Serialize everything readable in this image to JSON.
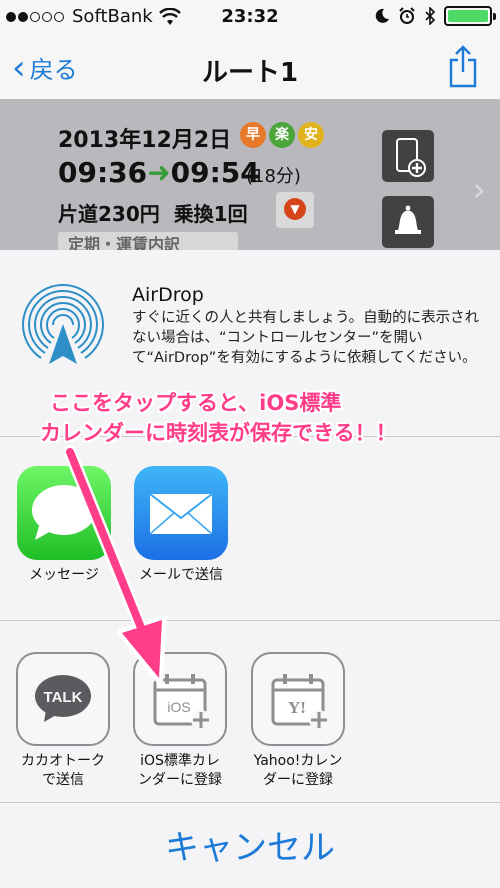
{
  "status_bar": {
    "carrier": "SoftBank",
    "time": "23:32"
  },
  "nav": {
    "back_label": "戻る",
    "title": "ルート1",
    "icons": [
      "chevron-left-icon",
      "share-icon"
    ]
  },
  "route": {
    "date": "2013年12月2日",
    "badges": [
      {
        "text": "早",
        "color": "#e8782a"
      },
      {
        "text": "楽",
        "color": "#4aa53a"
      },
      {
        "text": "安",
        "color": "#e0b21e"
      }
    ],
    "departure": "09:36",
    "arrival": "09:54",
    "duration": "(18分)",
    "fare": "片道230円",
    "transfers": "乗換1回",
    "tag": "定期・運賃内訳",
    "side_icons": [
      "add-to-phone-icon",
      "bell-icon"
    ]
  },
  "share_sheet": {
    "airdrop": {
      "title": "AirDrop",
      "description": "すぐに近くの人と共有しましょう。自動的に表示されない場合は、“コントロールセンター”を開いて“AirDrop”を有効にするように依頼してください。"
    },
    "apps_row1": [
      {
        "label": "メッセージ",
        "icon": "messages-icon"
      },
      {
        "label": "メールで送信",
        "icon": "mail-icon"
      }
    ],
    "apps_row2": [
      {
        "label_line1": "カカオトーク",
        "label_line2": "で送信",
        "icon": "kakaotalk-icon",
        "icon_text": "TALK"
      },
      {
        "label_line1": "iOS標準カレ",
        "label_line2": "ンダーに登録",
        "icon": "ios-calendar-add-icon",
        "icon_text": "iOS"
      },
      {
        "label_line1": "Yahoo!カレン",
        "label_line2": "ダーに登録",
        "icon": "yahoo-calendar-add-icon",
        "icon_text": "Y!"
      }
    ],
    "cancel_label": "キャンセル"
  },
  "annotation": {
    "line1": "ここをタップすると、iOS標準",
    "line2": "カレンダーに時刻表が保存できる！！",
    "color": "#ff3d89"
  }
}
